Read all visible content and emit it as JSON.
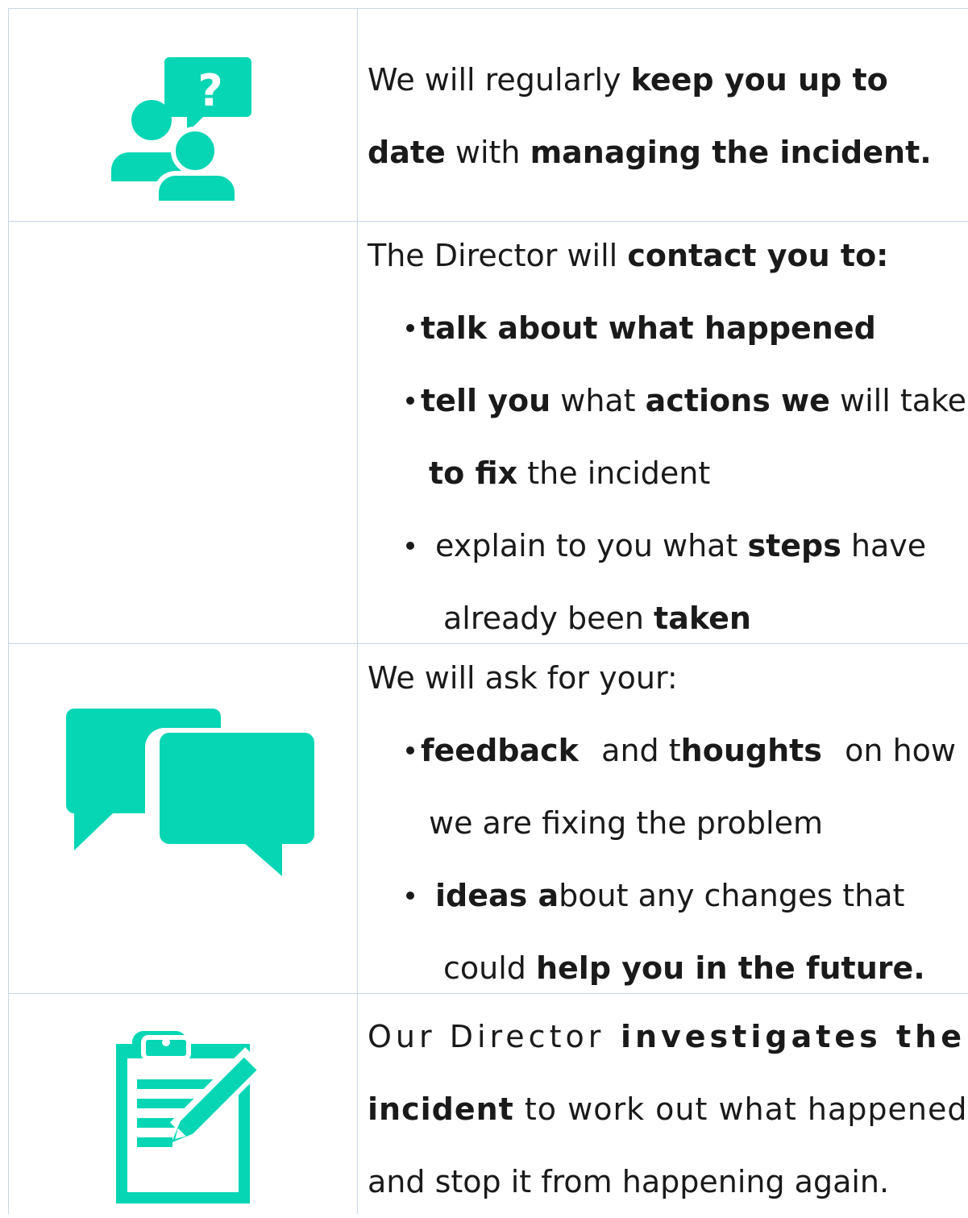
{
  "accent_color": "#06d6b4",
  "rows": [
    {
      "icon": "question-chat-people-icon",
      "lines": [
        {
          "a": "We will regularly ",
          "b": "keep you up to"
        },
        {
          "b1": "date",
          "a": " with ",
          "b2": "managing the incident."
        }
      ]
    },
    {
      "icon": "",
      "intro": {
        "a": "The Director will ",
        "b": "contact you to:"
      },
      "bullets": [
        {
          "b": "talk about what happened"
        },
        {
          "b1": "tell you",
          "a1": " what ",
          "b2": "actions we",
          "a2": " will take"
        },
        {
          "b": "to fix",
          "a": " the incident"
        },
        {
          "a1": "explain to you what ",
          "b": "steps",
          "a2": " have"
        },
        {
          "a": "already been ",
          "b": "taken"
        }
      ]
    },
    {
      "icon": "speech-bubbles-icon",
      "intro": "We will ask for your:",
      "bullets": [
        {
          "b1": "feedback",
          "a1": "and t",
          "b2": "houghts",
          "a2": "on how"
        },
        {
          "a": "we are fixing the problem"
        },
        {
          "b": "ideas a",
          "a": "bout any changes that"
        },
        {
          "a": "could ",
          "b": "help you in the future."
        }
      ]
    },
    {
      "icon": "clipboard-pencil-icon",
      "lines": [
        {
          "a": "Our Director ",
          "b": "investigates the"
        },
        {
          "b": "incident",
          "a": " to work out what happened"
        },
        {
          "a": "and stop it from happening again."
        }
      ]
    }
  ]
}
